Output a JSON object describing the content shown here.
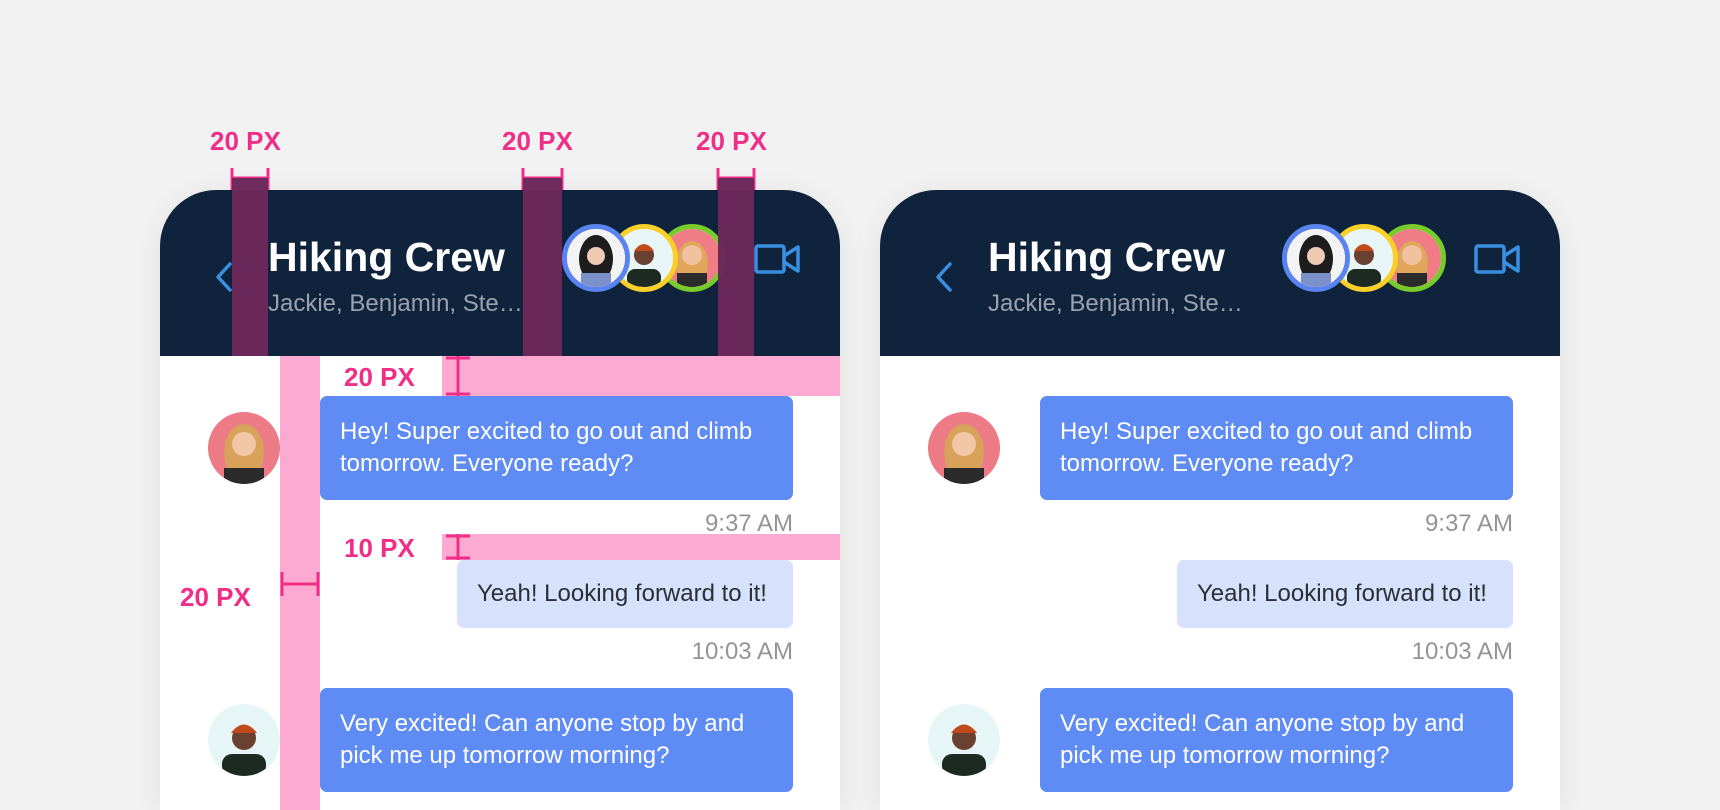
{
  "colors": {
    "header_bg": "#0f233c",
    "accent_blue": "#3a8fe0",
    "incoming_bubble": "#5f8cf4",
    "outgoing_bubble": "#d6e2fc",
    "spec_magenta": "#f02d87",
    "spec_pink": "#fdaad3",
    "ring_blue": "#5a83ef",
    "ring_yellow": "#f9cf28",
    "ring_green": "#77cc2b"
  },
  "header": {
    "back_icon": "chevron-left-icon",
    "title": "Hiking Crew",
    "subtitle": "Jackie, Benjamin, Ste…",
    "video_icon": "video-camera-icon"
  },
  "messages": [
    {
      "kind": "incoming",
      "avatar": "woman-avatar",
      "text": "Hey! Super excited to go out and climb tomorrow. Everyone ready?",
      "time": "9:37 AM"
    },
    {
      "kind": "outgoing",
      "text": "Yeah! Looking forward to it!",
      "time": "10:03 AM"
    },
    {
      "kind": "incoming",
      "avatar": "man-avatar",
      "text": "Very excited! Can anyone stop by and pick me up tomorrow morning?"
    }
  ],
  "spec": {
    "header_gap_1": "20 PX",
    "header_gap_2": "20 PX",
    "header_gap_3": "20 PX",
    "top_padding": "20 PX",
    "message_gap": "10 PX",
    "avatar_gap": "20 PX"
  }
}
